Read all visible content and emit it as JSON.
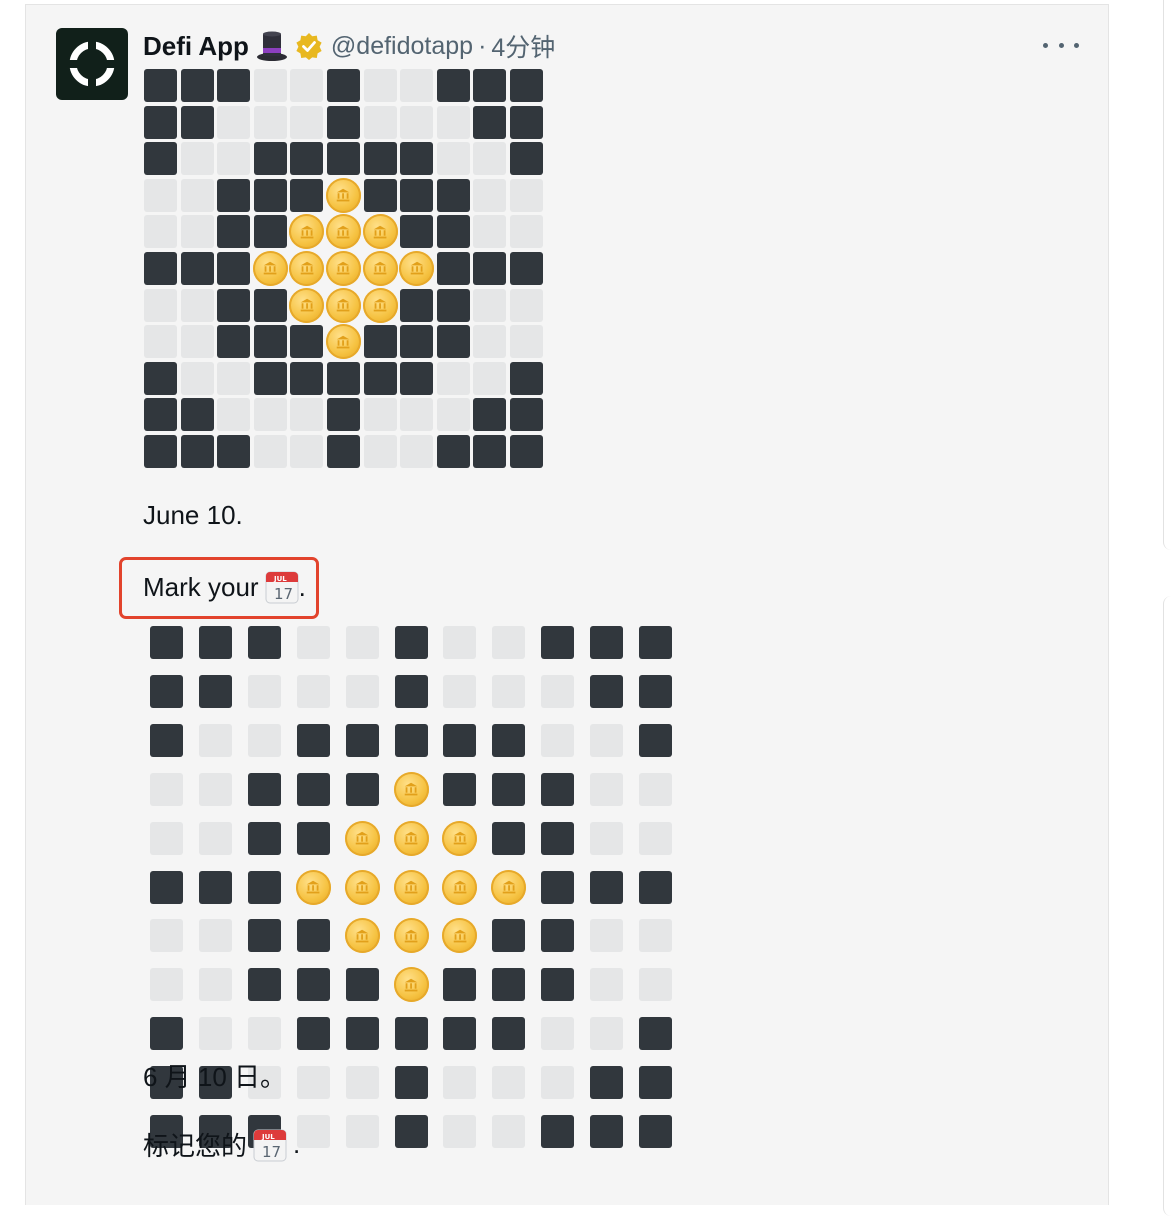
{
  "post": {
    "display_name": "Defi App",
    "hat_icon": "top-hat-icon",
    "verified_icon": "verified-badge-icon",
    "handle": "@defidotapp",
    "separator": "·",
    "time": "4分钟",
    "more_icon": "more-options-icon"
  },
  "body": {
    "line1": "June 10.",
    "line2_text": "Mark your",
    "line2_suffix": ".",
    "line3": "6 月 10 日。",
    "line4_text": "标记您的",
    "line4_suffix": ".",
    "calendar_month": "JUL",
    "calendar_day": "17"
  },
  "colors": {
    "dark_tile": "#31373d",
    "light_tile": "#e5e6e7",
    "coin": "#f6c343",
    "highlight": "#e2432c"
  },
  "pattern": [
    "DDDLLDLLDDD",
    "DDLLLDLLLDD",
    "DLLDDDDDLLD",
    "LLDDDCDDDLL",
    "LLDDCCCDDLL",
    "DDDCCCCCDDD",
    "LLDDCCCDDLL",
    "LLDDDCDDDLL",
    "DLLDDDDDLLD",
    "DDLLLDLLLDD",
    "DDDLLDLLDDD"
  ]
}
